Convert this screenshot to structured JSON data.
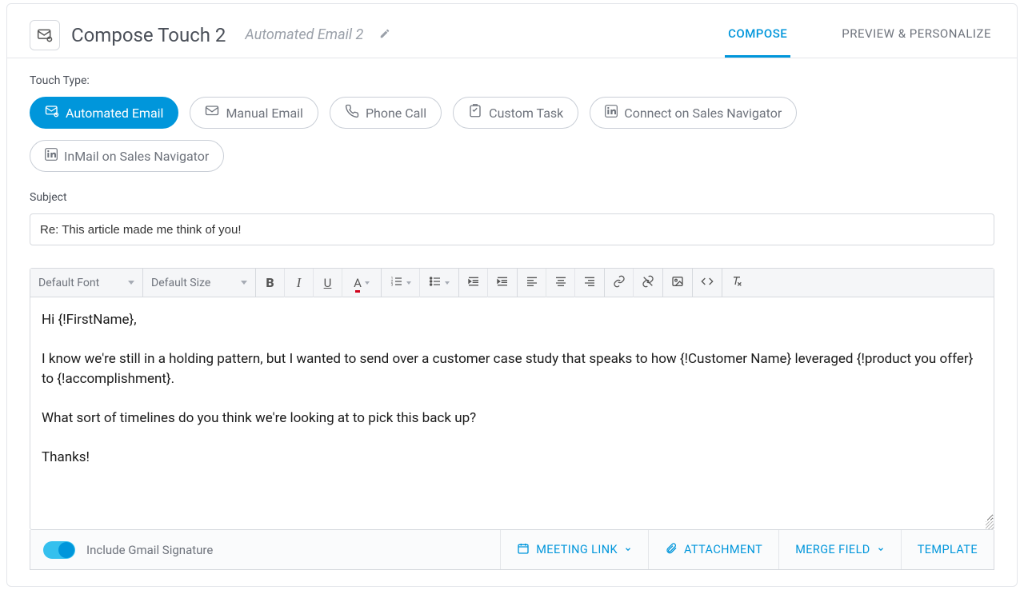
{
  "header": {
    "title": "Compose Touch 2",
    "subtitle": "Automated Email 2",
    "tabs": {
      "compose": "COMPOSE",
      "preview": "PREVIEW & PERSONALIZE"
    }
  },
  "touchType": {
    "label": "Touch Type:",
    "options": {
      "automated_email": "Automated Email",
      "manual_email": "Manual Email",
      "phone_call": "Phone Call",
      "custom_task": "Custom Task",
      "connect_nav": "Connect on Sales Navigator",
      "inmail_nav": "InMail on Sales Navigator"
    }
  },
  "subject": {
    "label": "Subject",
    "value": "Re: This article made me think of you!"
  },
  "toolbar": {
    "font_select": "Default Font",
    "size_select": "Default Size"
  },
  "body_text": "Hi {!FirstName},\n\nI know we're still in a holding pattern, but I wanted to send over a customer case study that speaks to how {!Customer Name} leveraged {!product you offer} to {!accomplishment}.\n\nWhat sort of timelines do you think we're looking at to pick this back up?\n\nThanks!",
  "footer": {
    "signature_label": "Include Gmail Signature",
    "meeting_link": "MEETING LINK",
    "attachment": "ATTACHMENT",
    "merge_field": "MERGE FIELD",
    "template": "TEMPLATE"
  }
}
